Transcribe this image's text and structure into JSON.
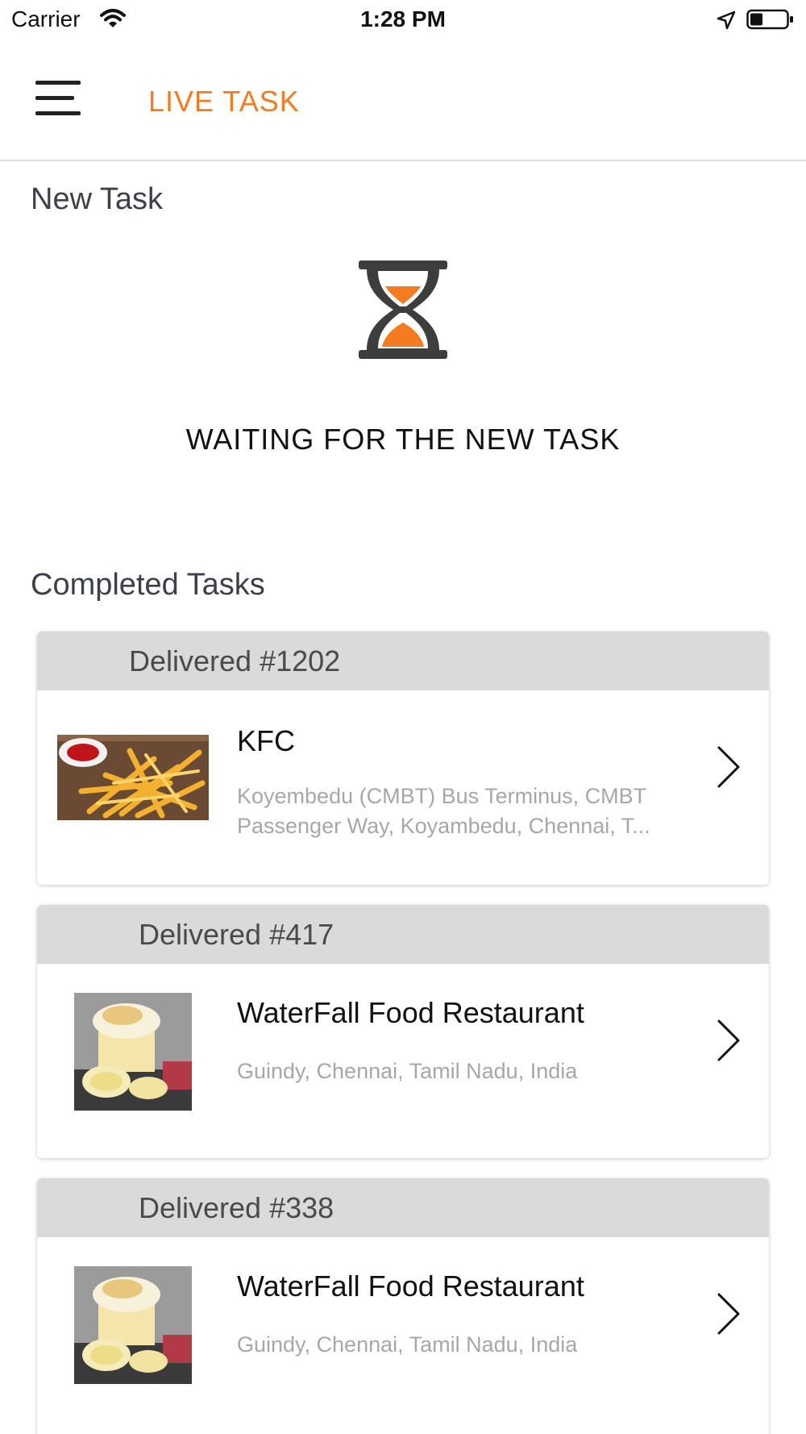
{
  "status_bar": {
    "carrier": "Carrier",
    "time": "1:28 PM"
  },
  "nav": {
    "title": "LIVE TASK",
    "accent_color": "#f47b20"
  },
  "new_task": {
    "heading": "New Task",
    "waiting_message": "WAITING FOR THE NEW TASK",
    "icon": "hourglass-icon"
  },
  "completed": {
    "heading": "Completed Tasks",
    "tasks": [
      {
        "status_label": "Delivered #1202",
        "name": "KFC",
        "address": "Koyembedu (CMBT) Bus Terminus, CMBT Passenger Way, Koyambedu, Chennai, T...",
        "image": "fries-with-ketchup"
      },
      {
        "status_label": "Delivered #417",
        "name": "WaterFall Food Restaurant",
        "address": "Guindy, Chennai, Tamil Nadu, India",
        "image": "meringue-cake"
      },
      {
        "status_label": "Delivered #338",
        "name": "WaterFall Food Restaurant",
        "address": "Guindy, Chennai, Tamil Nadu, India",
        "image": "meringue-cake"
      }
    ]
  }
}
